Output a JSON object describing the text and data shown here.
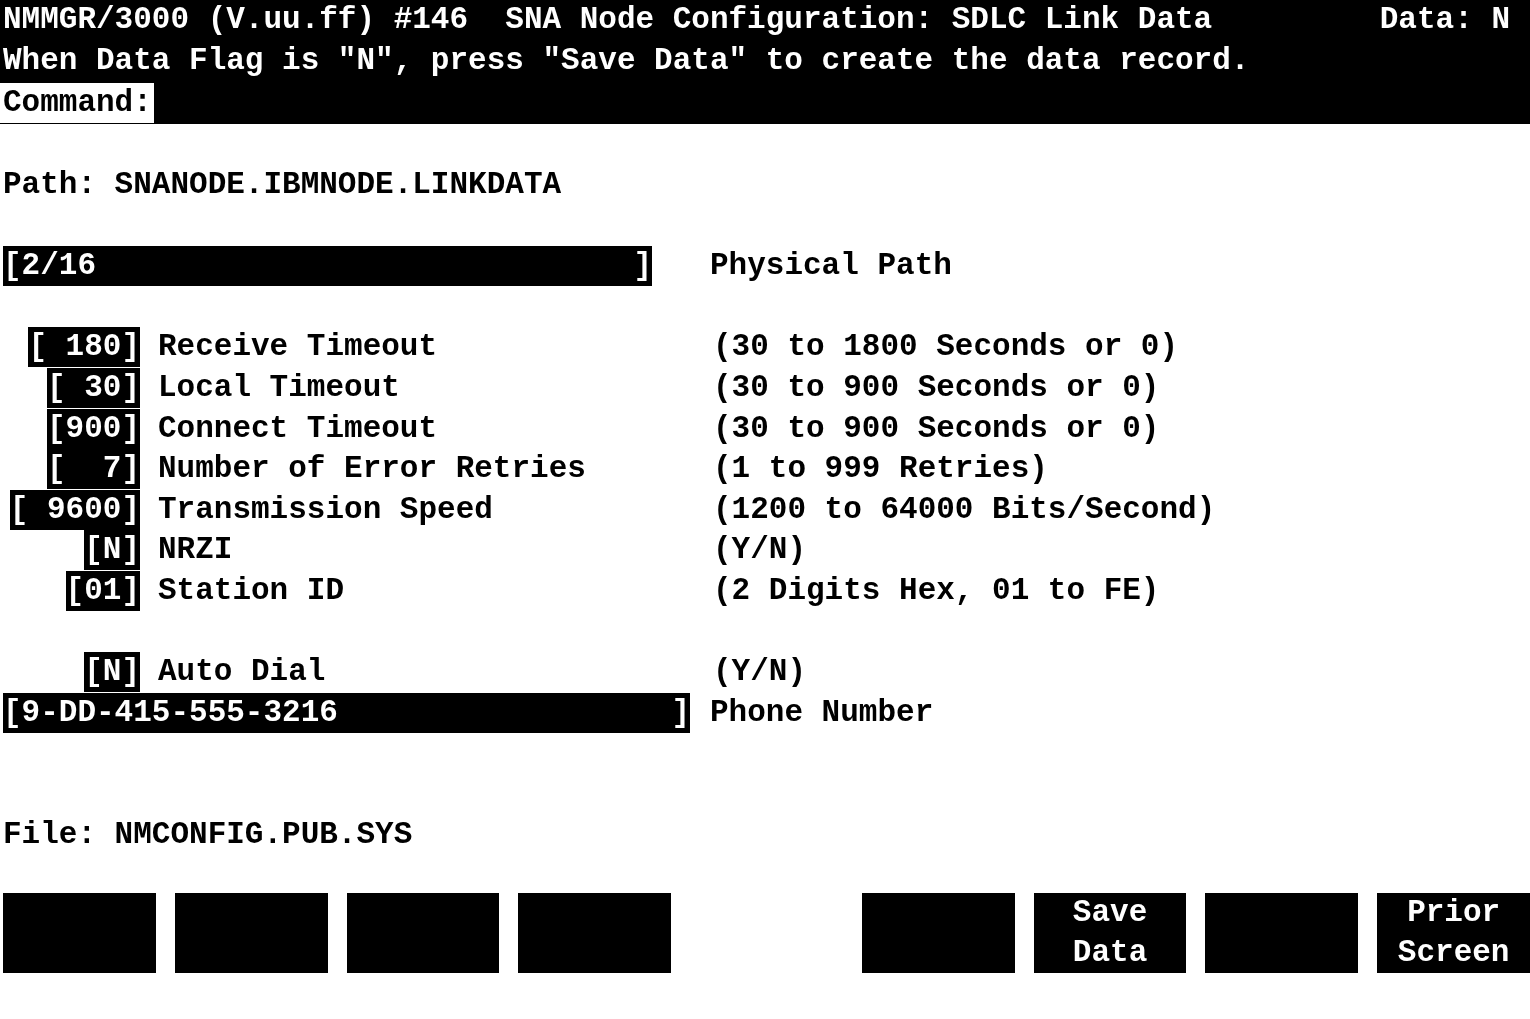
{
  "header": {
    "title": "NMMGR/3000 (V.uu.ff) #146  SNA Node Configuration: SDLC Link Data",
    "data_flag": "Data: N",
    "message": "When Data Flag is \"N\", press \"Save Data\" to create the data record.",
    "command_label": "Command:"
  },
  "path": "Path: SNANODE.IBMNODE.LINKDATA",
  "physical_path": {
    "value": "[2/16",
    "end": "]",
    "label": "Physical Path"
  },
  "parameters": [
    {
      "field": "[ 180]",
      "label": "Receive Timeout",
      "range": "(30 to 1800 Seconds or 0)"
    },
    {
      "field": "[ 30]",
      "label": "Local Timeout",
      "range": "(30 to 900 Seconds or 0)"
    },
    {
      "field": "[900]",
      "label": "Connect Timeout",
      "range": "(30 to 900 Seconds or 0)"
    },
    {
      "field": "[  7]",
      "label": "Number of Error Retries",
      "range": "(1 to 999 Retries)"
    },
    {
      "field": "[ 9600]",
      "label": "Transmission Speed",
      "range": "(1200 to 64000 Bits/Second)"
    },
    {
      "field": "[N]",
      "label": "NRZI",
      "range": "(Y/N)"
    },
    {
      "field": "[01]",
      "label": "Station ID",
      "range": "(2 Digits Hex, 01 to FE)"
    }
  ],
  "auto_dial": {
    "field": "[N]",
    "label": "Auto Dial",
    "range": "(Y/N)"
  },
  "phone": {
    "value": "[9-DD-415-555-3216",
    "end": "]",
    "label": "Phone Number"
  },
  "file": "File: NMCONFIG.PUB.SYS",
  "function_keys": [
    {
      "kind": "blank"
    },
    {
      "kind": "blank"
    },
    {
      "kind": "blank"
    },
    {
      "kind": "blank"
    },
    {
      "kind": "gap"
    },
    {
      "kind": "blank"
    },
    {
      "kind": "labeled",
      "lines": [
        "Save",
        "Data"
      ]
    },
    {
      "kind": "blank"
    },
    {
      "kind": "labeled",
      "lines": [
        "Prior",
        "Screen"
      ]
    }
  ]
}
